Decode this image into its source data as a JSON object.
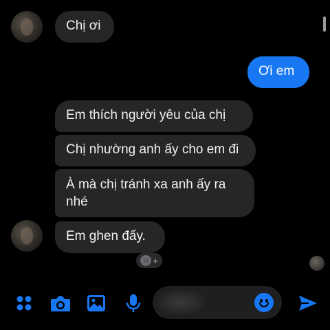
{
  "conversation": {
    "messages": [
      {
        "direction": "in",
        "text": "Chị ơi"
      },
      {
        "direction": "out",
        "text": "Ơi em"
      },
      {
        "direction": "in",
        "text": "Em thích người yêu của chị"
      },
      {
        "direction": "in",
        "text": "Chị nhường anh ấy cho em đi"
      },
      {
        "direction": "in",
        "text": "À mà chị tránh xa anh ấy ra nhé"
      },
      {
        "direction": "in",
        "text": "Em ghen đấy."
      }
    ],
    "reaction_badge": "+"
  },
  "toolbar": {
    "icons": [
      "apps-grid-icon",
      "camera-icon",
      "gallery-icon",
      "microphone-icon",
      "emoji-icon",
      "send-icon"
    ],
    "composer_placeholder": ""
  },
  "colors": {
    "background": "#000000",
    "incoming_bubble": "#262628",
    "outgoing_bubble": "#1877f2",
    "accent": "#1877f2"
  }
}
